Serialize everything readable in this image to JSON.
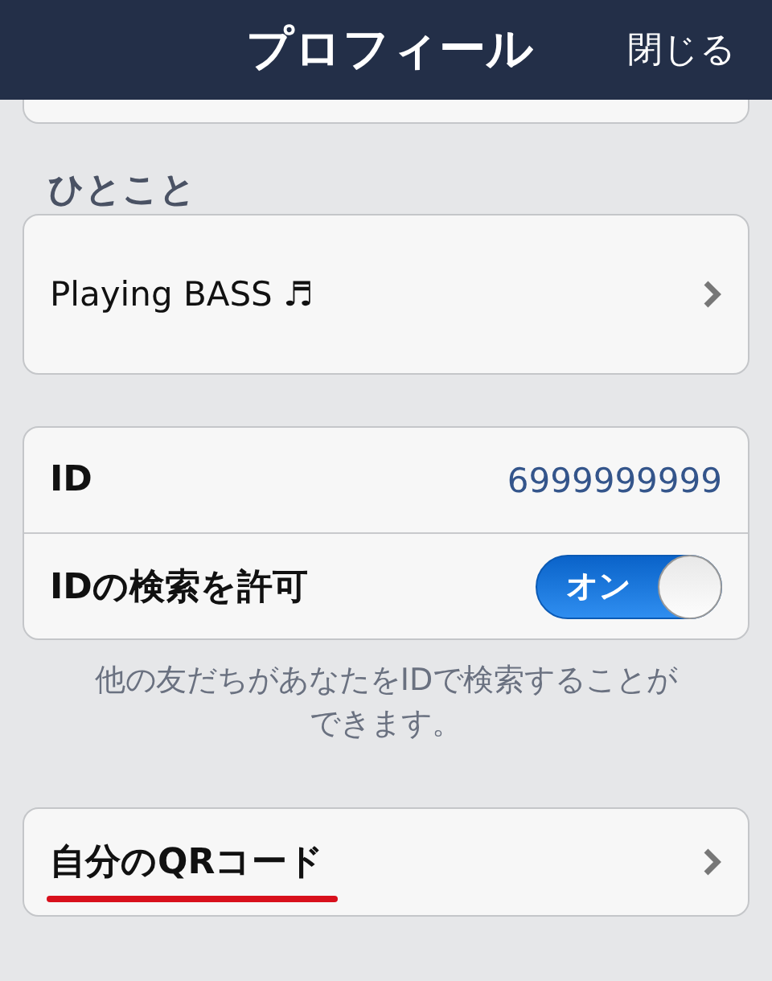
{
  "header": {
    "title": "プロフィール",
    "close_label": "閉じる"
  },
  "status_section": {
    "label": "ひとこと",
    "message": "Playing BASS ♬"
  },
  "id_section": {
    "rows": [
      {
        "kind": "value",
        "label": "ID",
        "value": "6999999999"
      },
      {
        "kind": "toggle",
        "label": "IDの検索を許可",
        "toggle_text": "オン",
        "on": true
      }
    ],
    "note": "他の友だちがあなたをIDで検索することができます。"
  },
  "qr_row": {
    "label": "自分のQRコード",
    "underlined": true
  }
}
